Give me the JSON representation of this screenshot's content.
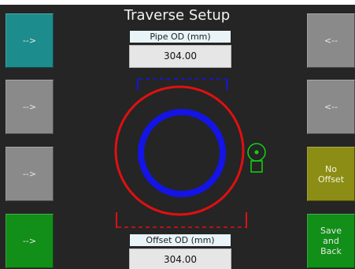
{
  "title": "Traverse Setup",
  "pipe_od": {
    "label": "Pipe OD (mm)",
    "value": "304.00"
  },
  "offset_od": {
    "label": "Offset OD (mm)",
    "value": "304.00"
  },
  "left_buttons": [
    {
      "label": "-->",
      "color": "#1d8c8c"
    },
    {
      "label": "-->",
      "color": "#8a8a8a"
    },
    {
      "label": "-->",
      "color": "#8a8a8a"
    },
    {
      "label": "-->",
      "color": "#118f18"
    }
  ],
  "right_buttons": [
    {
      "label": "<--",
      "color": "#8a8a8a"
    },
    {
      "label": "<--",
      "color": "#8a8a8a"
    },
    {
      "label": "No\nOffset",
      "color": "#8c8d14"
    },
    {
      "label": "Save\nand\nBack",
      "color": "#118f18"
    }
  ],
  "colors": {
    "background": "#252525",
    "outer_circle": "#e01010",
    "inner_circle": "#1414e6",
    "sensor": "#11d411"
  }
}
